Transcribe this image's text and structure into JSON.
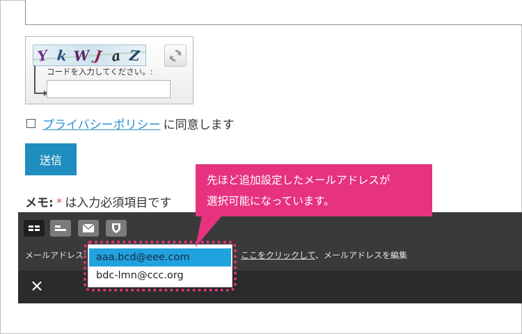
{
  "captcha": {
    "code_chars": [
      "Y",
      "k",
      "W",
      "J",
      "a",
      "Z"
    ],
    "code_colors": [
      "#7a2e8e",
      "#2a4f7a",
      "#5b2a6e",
      "#8a2b54",
      "#2f2f2f",
      "#1f3f66"
    ],
    "input_label": "コードを入力してください。:",
    "input_value": ""
  },
  "privacy": {
    "link_text": "プライバシーポリシー",
    "suffix_text": "に同意します"
  },
  "submit_label": "送信",
  "memo": {
    "label": "メモ:",
    "asterisk": "*",
    "text": "は入力必須項目です"
  },
  "toolbar": {
    "email_label": "メールアドレス:",
    "email_options": [
      "aaa.bcd@eee.com",
      "bdc-lmn@ccc.org"
    ],
    "selected_option": "aaa.bcd@eee.com",
    "edit_link_text": "ここをクリックして",
    "edit_suffix": "、メールアドレスを編集",
    "close_icon": "close-icon"
  },
  "callout": {
    "line1": "先ほど追加設定したメールアドレスが",
    "line2": "選択可能になっています。"
  },
  "colors": {
    "accent_pink": "#e6327f",
    "submit_blue": "#1f8dbd",
    "link_blue": "#2b8fcf",
    "selected_blue": "#1fa2dd"
  }
}
